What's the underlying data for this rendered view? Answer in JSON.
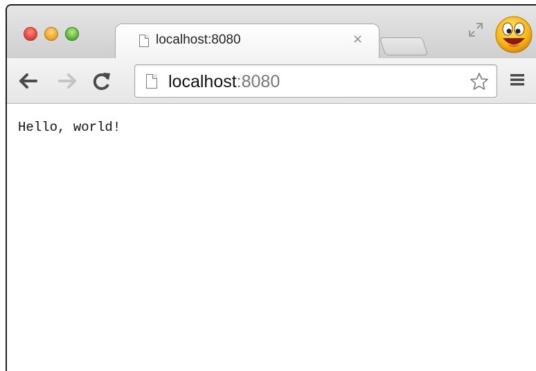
{
  "browser": {
    "tab": {
      "title": "localhost:8080",
      "close_glyph": "×",
      "icon": "page-icon"
    },
    "toolbar": {
      "back_icon": "arrow-left-icon",
      "forward_icon": "arrow-right-icon",
      "reload_icon": "reload-icon",
      "menu_icon": "hamburger-menu-icon",
      "bookmark_icon": "star-icon"
    },
    "omnibox": {
      "host": "localhost",
      "port": ":8080"
    },
    "window_controls": [
      "close",
      "minimize",
      "zoom"
    ],
    "profile_avatar_icon": "smiley-face-icon",
    "fullscreen_icon": "fullscreen-icon"
  },
  "page": {
    "body_text": "Hello, world!"
  },
  "colors": {
    "traffic_red": "#e4473c",
    "traffic_yellow": "#f0a82a",
    "traffic_green": "#62b83c",
    "url_port_gray": "#777777"
  }
}
